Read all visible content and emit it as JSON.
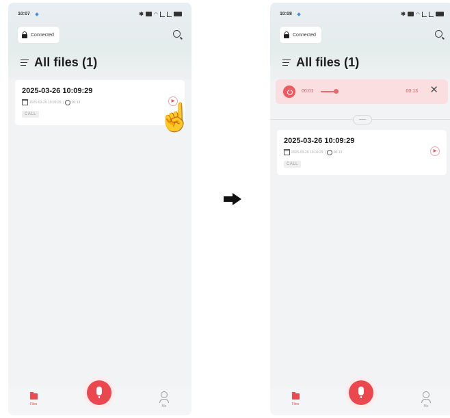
{
  "left": {
    "status_time": "10:07",
    "connection": "Connected",
    "title": "All files (1)",
    "file": {
      "name": "2025-03-26 10:09:29",
      "meta_date": "2025-03-26 10:09:29",
      "meta_duration": "00:13",
      "tag": "CALL"
    },
    "tabs": {
      "files": "Files",
      "me": "Me"
    }
  },
  "right": {
    "status_time": "10:08",
    "connection": "Connected",
    "title": "All files (1)",
    "player": {
      "elapsed": "00:01",
      "total": "00:13"
    },
    "file": {
      "name": "2025-03-26 10:09:29",
      "meta_date": "2025-03-26 10:09:29",
      "meta_duration": "00:13",
      "tag": "CALL"
    },
    "tabs": {
      "files": "Files",
      "me": "Me"
    }
  },
  "colors": {
    "accent": "#ea474e",
    "player_bg": "#fbdfe0"
  },
  "icons": [
    "lock-icon",
    "search-icon",
    "menu-icon",
    "calendar-icon",
    "clock-icon",
    "play-icon",
    "pointer-hand-icon",
    "record-icon",
    "close-icon",
    "folder-icon",
    "microphone-icon",
    "person-icon",
    "arrow-right-icon"
  ]
}
